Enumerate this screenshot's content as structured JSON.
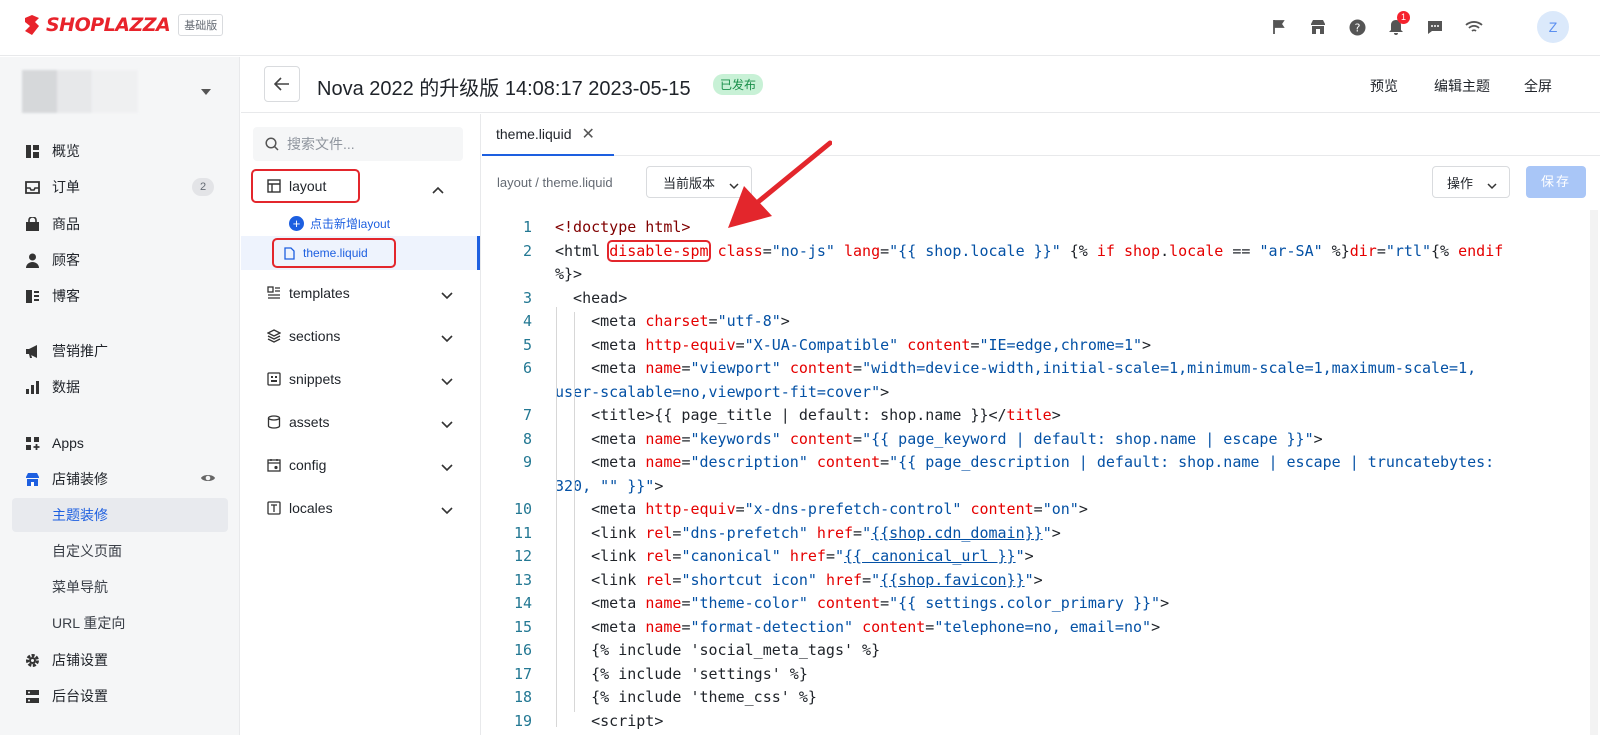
{
  "brand": {
    "logo_text": "SHOPLAZZA",
    "edition": "基础版",
    "logo_color": "#e8232b"
  },
  "topbar": {
    "notification_count": "1",
    "avatar_initial": "Z",
    "icons": [
      "flag-icon",
      "store-icon",
      "help-icon",
      "bell-icon",
      "message-icon",
      "wifi-icon"
    ]
  },
  "sidebar": {
    "items": [
      {
        "label": "概览",
        "icon": "overview-icon"
      },
      {
        "label": "订单",
        "icon": "inbox-icon",
        "count": "2"
      },
      {
        "label": "商品",
        "icon": "bag-icon"
      },
      {
        "label": "顾客",
        "icon": "person-icon"
      },
      {
        "label": "博客",
        "icon": "blog-icon"
      },
      {
        "label": "营销推广",
        "icon": "megaphone-icon"
      },
      {
        "label": "数据",
        "icon": "bar-chart-icon"
      },
      {
        "label": "Apps",
        "icon": "apps-icon"
      },
      {
        "label": "店铺装修",
        "icon": "storefront-icon"
      },
      {
        "label": "店铺设置",
        "icon": "gear-icon"
      },
      {
        "label": "后台设置",
        "icon": "server-icon"
      }
    ],
    "subitems": [
      "主题装修",
      "自定义页面",
      "菜单导航",
      "URL 重定向"
    ],
    "active": "主题装修"
  },
  "header": {
    "title": "Nova 2022 的升级版 14:08:17 2023-05-15",
    "status": "已发布",
    "links": [
      "预览",
      "编辑主题",
      "全屏"
    ]
  },
  "filetree": {
    "search_placeholder": "搜索文件...",
    "folders": [
      "layout",
      "templates",
      "sections",
      "snippets",
      "assets",
      "config",
      "locales"
    ],
    "add_layout": "点击新增layout",
    "files": [
      "theme.liquid"
    ]
  },
  "editor": {
    "tab": "theme.liquid",
    "path": "layout / theme.liquid",
    "version": "当前版本",
    "operations": "操作",
    "save": "保存",
    "accent_color": "#1d5fe0",
    "lines": [
      {
        "n": "1",
        "segs": [
          [
            "t",
            "<!doctype html>"
          ]
        ]
      },
      {
        "n": "2",
        "segs": [
          [
            "p",
            "<html "
          ],
          [
            "h",
            "disable-spm"
          ],
          [
            "p",
            " "
          ],
          [
            "a",
            "class"
          ],
          [
            "p",
            "="
          ],
          [
            "s",
            "\"no-js\""
          ],
          [
            "p",
            " "
          ],
          [
            "a",
            "lang"
          ],
          [
            "p",
            "="
          ],
          [
            "s",
            "\"{{ shop.locale }}\""
          ],
          [
            "p",
            " {% "
          ],
          [
            "a",
            "if"
          ],
          [
            "p",
            " "
          ],
          [
            "a",
            "shop"
          ],
          [
            "p",
            "."
          ],
          [
            "a",
            "locale"
          ],
          [
            "p",
            " == "
          ],
          [
            "s",
            "\"ar-SA\""
          ],
          [
            "p",
            " %}"
          ],
          [
            "a",
            "dir"
          ],
          [
            "p",
            "="
          ],
          [
            "s",
            "\"rtl\""
          ],
          [
            "p",
            "{% "
          ],
          [
            "a",
            "endif"
          ]
        ]
      },
      {
        "n": "",
        "segs": [
          [
            "p",
            "%}>"
          ]
        ]
      },
      {
        "n": "3",
        "segs": [
          [
            "p",
            "  <head>"
          ]
        ]
      },
      {
        "n": "4",
        "segs": [
          [
            "p",
            "    <meta "
          ],
          [
            "a",
            "charset"
          ],
          [
            "p",
            "="
          ],
          [
            "s",
            "\"utf-8\""
          ],
          [
            "p",
            ">"
          ]
        ]
      },
      {
        "n": "5",
        "segs": [
          [
            "p",
            "    <meta "
          ],
          [
            "a",
            "http-equiv"
          ],
          [
            "p",
            "="
          ],
          [
            "s",
            "\"X-UA-Compatible\""
          ],
          [
            "p",
            " "
          ],
          [
            "a",
            "content"
          ],
          [
            "p",
            "="
          ],
          [
            "s",
            "\"IE=edge,chrome=1\""
          ],
          [
            "p",
            ">"
          ]
        ]
      },
      {
        "n": "6",
        "segs": [
          [
            "p",
            "    <meta "
          ],
          [
            "a",
            "name"
          ],
          [
            "p",
            "="
          ],
          [
            "s",
            "\"viewport\""
          ],
          [
            "p",
            " "
          ],
          [
            "a",
            "content"
          ],
          [
            "p",
            "="
          ],
          [
            "s",
            "\"width=device-width,initial-scale=1,minimum-scale=1,maximum-scale=1,"
          ]
        ]
      },
      {
        "n": "",
        "segs": [
          [
            "s",
            "user-scalable=no,viewport-fit=cover\""
          ],
          [
            "p",
            ">"
          ]
        ]
      },
      {
        "n": "7",
        "segs": [
          [
            "p",
            "    <title>{{ page_title | default: shop.name }}</"
          ],
          [
            "a",
            "title"
          ],
          [
            "p",
            ">"
          ]
        ]
      },
      {
        "n": "8",
        "segs": [
          [
            "p",
            "    <meta "
          ],
          [
            "a",
            "name"
          ],
          [
            "p",
            "="
          ],
          [
            "s",
            "\"keywords\""
          ],
          [
            "p",
            " "
          ],
          [
            "a",
            "content"
          ],
          [
            "p",
            "="
          ],
          [
            "s",
            "\"{{ page_keyword | default: shop.name | escape }}\""
          ],
          [
            "p",
            ">"
          ]
        ]
      },
      {
        "n": "9",
        "segs": [
          [
            "p",
            "    <meta "
          ],
          [
            "a",
            "name"
          ],
          [
            "p",
            "="
          ],
          [
            "s",
            "\"description\""
          ],
          [
            "p",
            " "
          ],
          [
            "a",
            "content"
          ],
          [
            "p",
            "="
          ],
          [
            "s",
            "\"{{ page_description | default: shop.name | escape | truncatebytes:"
          ]
        ]
      },
      {
        "n": "",
        "segs": [
          [
            "s",
            "320, \"\" }}\""
          ],
          [
            "p",
            ">"
          ]
        ]
      },
      {
        "n": "10",
        "segs": [
          [
            "p",
            "    <meta "
          ],
          [
            "a",
            "http-equiv"
          ],
          [
            "p",
            "="
          ],
          [
            "s",
            "\"x-dns-prefetch-control\""
          ],
          [
            "p",
            " "
          ],
          [
            "a",
            "content"
          ],
          [
            "p",
            "="
          ],
          [
            "s",
            "\"on\""
          ],
          [
            "p",
            ">"
          ]
        ]
      },
      {
        "n": "11",
        "segs": [
          [
            "p",
            "    <link "
          ],
          [
            "a",
            "rel"
          ],
          [
            "p",
            "="
          ],
          [
            "s",
            "\"dns-prefetch\""
          ],
          [
            "p",
            " "
          ],
          [
            "a",
            "href"
          ],
          [
            "p",
            "="
          ],
          [
            "s",
            "\""
          ],
          [
            "su",
            "{{shop.cdn_domain}}"
          ],
          [
            "s",
            "\""
          ],
          [
            "p",
            ">"
          ]
        ]
      },
      {
        "n": "12",
        "segs": [
          [
            "p",
            "    <link "
          ],
          [
            "a",
            "rel"
          ],
          [
            "p",
            "="
          ],
          [
            "s",
            "\"canonical\""
          ],
          [
            "p",
            " "
          ],
          [
            "a",
            "href"
          ],
          [
            "p",
            "="
          ],
          [
            "s",
            "\""
          ],
          [
            "su",
            "{{ canonical_url }}"
          ],
          [
            "s",
            "\""
          ],
          [
            "p",
            ">"
          ]
        ]
      },
      {
        "n": "13",
        "segs": [
          [
            "p",
            "    <link "
          ],
          [
            "a",
            "rel"
          ],
          [
            "p",
            "="
          ],
          [
            "s",
            "\"shortcut icon\""
          ],
          [
            "p",
            " "
          ],
          [
            "a",
            "href"
          ],
          [
            "p",
            "="
          ],
          [
            "s",
            "\""
          ],
          [
            "su",
            "{{shop.favicon}}"
          ],
          [
            "s",
            "\""
          ],
          [
            "p",
            ">"
          ]
        ]
      },
      {
        "n": "14",
        "segs": [
          [
            "p",
            "    <meta "
          ],
          [
            "a",
            "name"
          ],
          [
            "p",
            "="
          ],
          [
            "s",
            "\"theme-color\""
          ],
          [
            "p",
            " "
          ],
          [
            "a",
            "content"
          ],
          [
            "p",
            "="
          ],
          [
            "s",
            "\"{{ settings.color_primary }}\""
          ],
          [
            "p",
            ">"
          ]
        ]
      },
      {
        "n": "15",
        "segs": [
          [
            "p",
            "    <meta "
          ],
          [
            "a",
            "name"
          ],
          [
            "p",
            "="
          ],
          [
            "s",
            "\"format-detection\""
          ],
          [
            "p",
            " "
          ],
          [
            "a",
            "content"
          ],
          [
            "p",
            "="
          ],
          [
            "s",
            "\"telephone=no, email=no\""
          ],
          [
            "p",
            ">"
          ]
        ]
      },
      {
        "n": "16",
        "segs": [
          [
            "p",
            "    {% include 'social_meta_tags' %}"
          ]
        ]
      },
      {
        "n": "17",
        "segs": [
          [
            "p",
            "    {% include 'settings' %}"
          ]
        ]
      },
      {
        "n": "18",
        "segs": [
          [
            "p",
            "    {% include 'theme_css' %}"
          ]
        ]
      },
      {
        "n": "19",
        "segs": [
          [
            "p",
            "    <script>"
          ]
        ]
      }
    ]
  }
}
